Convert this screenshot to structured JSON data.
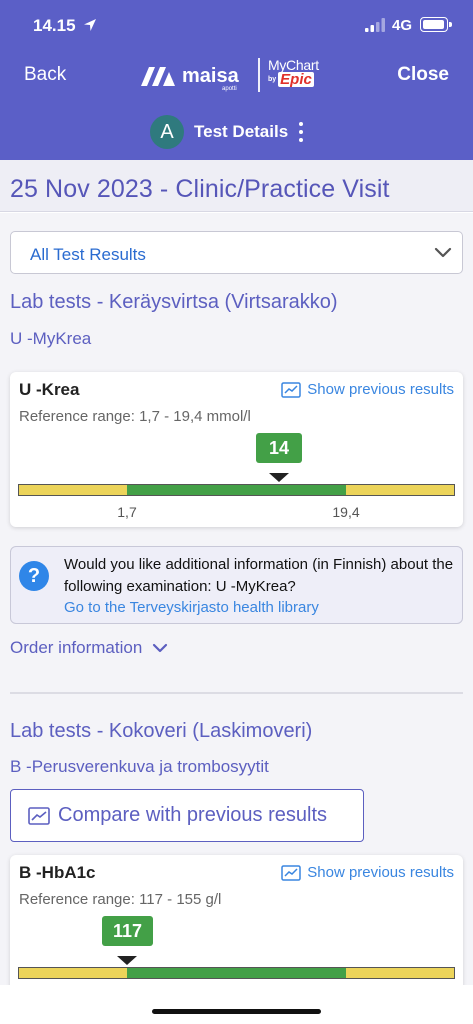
{
  "status_bar": {
    "time": "14.15",
    "network": "4G"
  },
  "nav": {
    "back_label": "Back",
    "close_label": "Close",
    "logo_maisa": "maisa",
    "logo_maisa_sub": "apotti",
    "logo_mychart": "MyChart",
    "logo_by": "by",
    "logo_epic": "Epic",
    "avatar_initial": "A",
    "page_context": "Test Details"
  },
  "page_title": "25 Nov 2023 - Clinic/Practice Visit",
  "filter": {
    "selected": "All Test Results"
  },
  "sections": [
    {
      "title": "Lab tests - Keräysvirtsa (Virtsarakko)",
      "subtitle": "U -MyKrea",
      "result": {
        "name": "U -Krea",
        "show_previous": "Show previous results",
        "reference": "Reference range: 1,7 - 19,4 mmol/l",
        "value": "14",
        "low_label": "1,7",
        "high_label": "19,4",
        "value_numeric": 14
      },
      "info": {
        "text": "Would you like additional information (in Finnish) about the following examination: U -MyKrea?",
        "link": "Go to the Terveyskirjasto health library"
      },
      "order_info": "Order information"
    },
    {
      "title": "Lab tests - Kokoveri (Laskimoveri)",
      "subtitle": "B -Perusverenkuva ja trombosyytit",
      "compare_label": "Compare with previous results",
      "result": {
        "name": "B -HbA1c",
        "show_previous": "Show previous results",
        "reference": "Reference range: 117 - 155 g/l",
        "value": "117",
        "value_numeric": 117
      }
    }
  ],
  "colors": {
    "header": "#5b5fc7",
    "accent_text": "#5c5fc0",
    "link": "#3a86e0",
    "in_range": "#43a047",
    "out_of_range": "#ecd45a"
  }
}
